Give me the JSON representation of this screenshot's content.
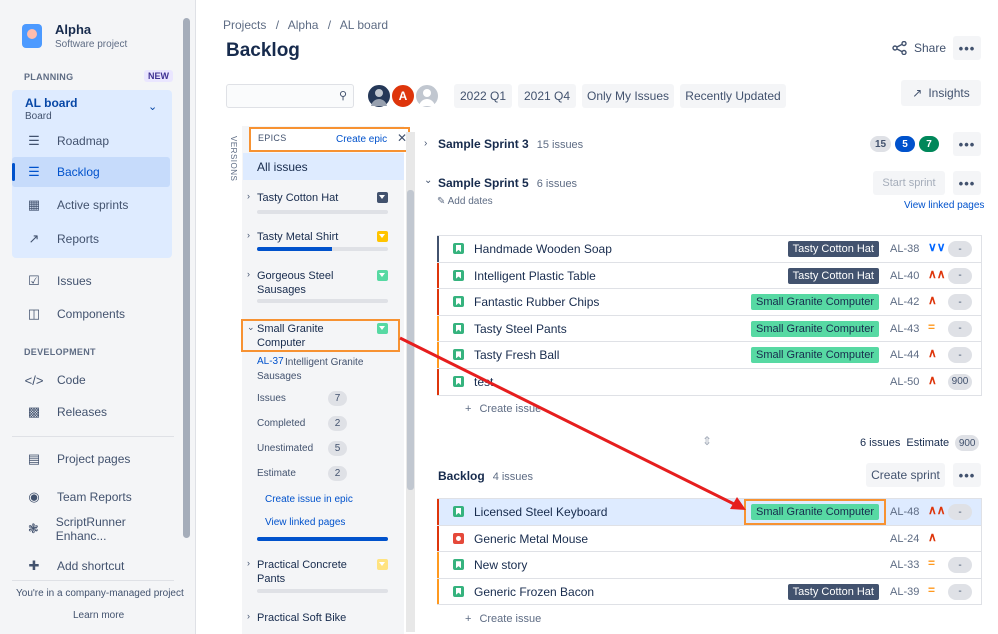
{
  "sidebar": {
    "project_name": "Alpha",
    "project_type": "Software project",
    "planning_title": "PLANNING",
    "new_badge": "NEW",
    "board_name": "AL board",
    "board_sub": "Board",
    "planning_items": [
      {
        "label": "Roadmap",
        "icon": "roadmap-icon"
      },
      {
        "label": "Backlog",
        "icon": "backlog-icon"
      },
      {
        "label": "Active sprints",
        "icon": "active-sprints-icon"
      },
      {
        "label": "Reports",
        "icon": "reports-icon"
      }
    ],
    "items": [
      {
        "label": "Issues",
        "icon": "issues-icon"
      },
      {
        "label": "Components",
        "icon": "components-icon"
      }
    ],
    "development_title": "DEVELOPMENT",
    "dev_items": [
      {
        "label": "Code",
        "icon": "code-icon"
      },
      {
        "label": "Releases",
        "icon": "releases-icon"
      }
    ],
    "bottom_items": [
      {
        "label": "Project pages",
        "icon": "page-icon"
      },
      {
        "label": "Team Reports",
        "icon": "team-reports-icon"
      },
      {
        "label": "ScriptRunner Enhanc...",
        "icon": "scriptrunner-icon"
      },
      {
        "label": "Add shortcut",
        "icon": "add-shortcut-icon"
      }
    ],
    "footer_text": "You're in a company-managed project",
    "learn_more": "Learn more"
  },
  "header": {
    "breadcrumbs": [
      "Projects",
      "/",
      "Alpha",
      "/",
      "AL board"
    ],
    "title": "Backlog",
    "share_label": "Share",
    "more_label": "•••"
  },
  "toolbar": {
    "avatar_letter": "A",
    "filters": [
      "2022 Q1",
      "2021 Q4",
      "Only My Issues",
      "Recently Updated"
    ],
    "insights_label": "Insights"
  },
  "epics": {
    "versions_tab": "VERSIONS",
    "title": "EPICS",
    "create_label": "Create epic",
    "close_label": "✕",
    "all_issues": "All issues",
    "list": [
      {
        "name": "Tasty Cotton Hat",
        "color": "#42526e",
        "progress": 0
      },
      {
        "name": "Tasty Metal Shirt",
        "color": "#ffc400",
        "progress": 0.6
      },
      {
        "name": "Gorgeous Steel Sausages",
        "color": "#57d9a3",
        "progress": 0
      },
      {
        "name": "Small Granite Computer",
        "color": "#57d9a3",
        "progress": 1
      },
      {
        "name": "Practical Concrete Pants",
        "color": "#ffe380",
        "progress": 0
      },
      {
        "name": "Practical Soft Bike",
        "color": "",
        "progress": 0
      }
    ],
    "detail": {
      "key": "AL-37",
      "summary": "Intelligent Granite Sausages",
      "stats": [
        {
          "label": "Issues",
          "value": "7"
        },
        {
          "label": "Completed",
          "value": "2"
        },
        {
          "label": "Unestimated",
          "value": "5"
        },
        {
          "label": "Estimate",
          "value": "2"
        }
      ],
      "create_link": "Create issue in epic",
      "view_link": "View linked pages"
    }
  },
  "sprint3": {
    "name": "Sample Sprint 3",
    "count": "15 issues",
    "badges": [
      "15",
      "5",
      "7"
    ]
  },
  "sprint5": {
    "name": "Sample Sprint 5",
    "count": "6 issues",
    "start_label": "Start sprint",
    "add_dates": "Add dates",
    "view_linked": "View linked pages",
    "create_issue": "Create issue",
    "summary_count": "6 issues",
    "summary_est_label": "Estimate",
    "summary_est": "900",
    "issues": [
      {
        "summary": "Handmade Wooden Soap",
        "epic": "Tasty Cotton Hat",
        "epic_style": "dark",
        "key": "AL-38",
        "prio": "lowest",
        "est": "-",
        "edge": "#42526e",
        "type": "story"
      },
      {
        "summary": "Intelligent Plastic Table",
        "epic": "Tasty Cotton Hat",
        "epic_style": "dark",
        "key": "AL-40",
        "prio": "highest",
        "est": "-",
        "edge": "#de350b",
        "type": "story"
      },
      {
        "summary": "Fantastic Rubber Chips",
        "epic": "Small Granite Computer",
        "epic_style": "green",
        "key": "AL-42",
        "prio": "high",
        "est": "-",
        "edge": "#de350b",
        "type": "story"
      },
      {
        "summary": "Tasty Steel Pants",
        "epic": "Small Granite Computer",
        "epic_style": "green",
        "key": "AL-43",
        "prio": "medium",
        "est": "-",
        "edge": "#ff991f",
        "type": "story"
      },
      {
        "summary": "Tasty Fresh Ball",
        "epic": "Small Granite Computer",
        "epic_style": "green",
        "key": "AL-44",
        "prio": "high",
        "est": "-",
        "edge": "#ff991f",
        "type": "story"
      },
      {
        "summary": "test",
        "epic": "",
        "epic_style": "",
        "key": "AL-50",
        "prio": "high",
        "est": "900",
        "edge": "#de350b",
        "type": "story"
      }
    ]
  },
  "backlog": {
    "name": "Backlog",
    "count": "4 issues",
    "create_sprint": "Create sprint",
    "create_issue": "Create issue",
    "issues": [
      {
        "summary": "Licensed Steel Keyboard",
        "epic": "Small Granite Computer",
        "epic_style": "green",
        "key": "AL-48",
        "prio": "highest",
        "est": "-",
        "edge": "#de350b",
        "type": "story",
        "selected": true
      },
      {
        "summary": "Generic Metal Mouse",
        "epic": "",
        "epic_style": "",
        "key": "AL-24",
        "prio": "high",
        "est": "",
        "edge": "#de350b",
        "type": "bug"
      },
      {
        "summary": "New story",
        "epic": "",
        "epic_style": "",
        "key": "AL-33",
        "prio": "medium",
        "est": "-",
        "edge": "#ff991f",
        "type": "story"
      },
      {
        "summary": "Generic Frozen Bacon",
        "epic": "Tasty Cotton Hat",
        "epic_style": "dark",
        "key": "AL-39",
        "prio": "medium",
        "est": "-",
        "edge": "#ff991f",
        "type": "story"
      }
    ]
  }
}
